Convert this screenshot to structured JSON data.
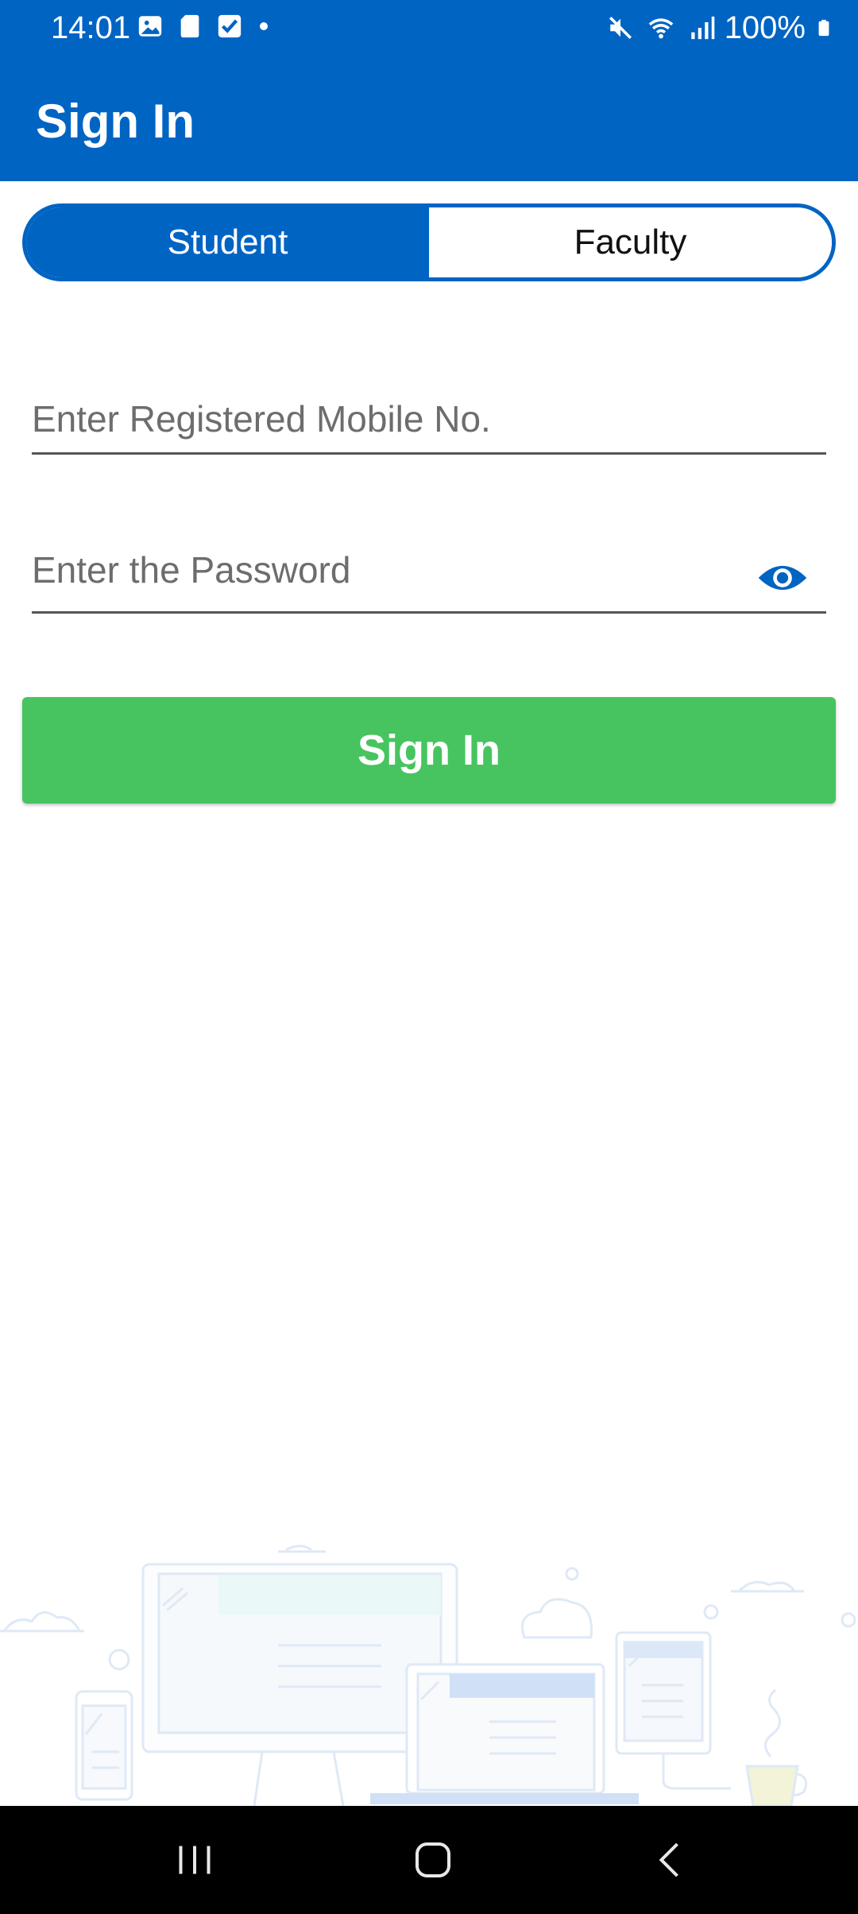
{
  "status_bar": {
    "time": "14:01",
    "battery": "100%",
    "icons": [
      "image-icon",
      "sd-card-icon",
      "checkbox-icon",
      "dot-icon",
      "mute-icon",
      "wifi-icon",
      "signal-icon",
      "battery-icon"
    ]
  },
  "app_bar": {
    "title": "Sign In"
  },
  "toggle": {
    "student_label": "Student",
    "faculty_label": "Faculty",
    "selected": "Student"
  },
  "form": {
    "mobile_placeholder": "Enter Registered Mobile No.",
    "password_placeholder": "Enter the Password",
    "mobile_value": "",
    "password_value": ""
  },
  "button": {
    "label": "Sign In"
  },
  "colors": {
    "primary": "#0064C3",
    "success": "#47C45F",
    "background": "#FFFFFF",
    "nav": "#000000"
  },
  "navbar": {
    "icons": [
      "recent-apps-icon",
      "home-icon",
      "back-icon"
    ]
  }
}
